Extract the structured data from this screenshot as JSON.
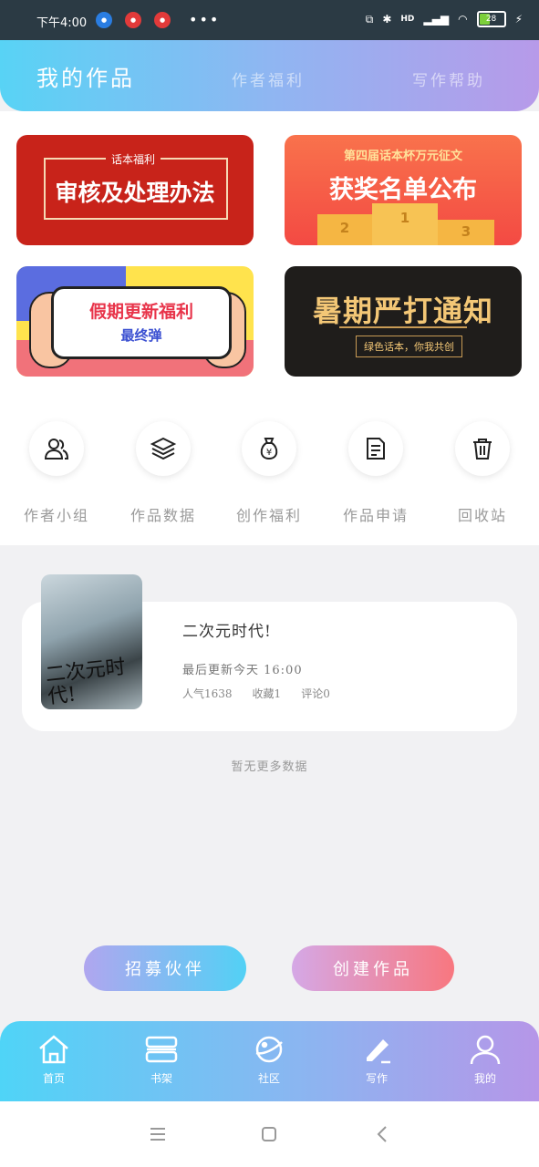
{
  "status_bar": {
    "time": "下午4:00",
    "more": "•••",
    "hd": "HD",
    "battery": "28"
  },
  "top_tabs": {
    "active": "我的作品",
    "tab2": "作者福利",
    "tab3": "写作帮助"
  },
  "banners": {
    "b1": {
      "tag": "话本福利",
      "title": "审核及处理办法"
    },
    "b2": {
      "subtitle": "第四届话本杯万元征文",
      "title": "获奖名单公布",
      "p1": "1",
      "p2": "2",
      "p3": "3"
    },
    "b3": {
      "title": "假期更新福利",
      "subtitle": "最终弹"
    },
    "b4": {
      "title": "暑期严打通知",
      "subtitle": "绿色话本，你我共创"
    }
  },
  "shortcuts": [
    {
      "label": "作者小组",
      "icon": "users-icon"
    },
    {
      "label": "作品数据",
      "icon": "layers-icon"
    },
    {
      "label": "创作福利",
      "icon": "money-bag-icon"
    },
    {
      "label": "作品申请",
      "icon": "document-icon"
    },
    {
      "label": "回收站",
      "icon": "trash-icon"
    }
  ],
  "work": {
    "cover_text": "二次元时代!",
    "title": "二次元时代!",
    "updated": "最后更新今天 16:00",
    "popularity": "人气1638",
    "favorites": "收藏1",
    "comments": "评论0"
  },
  "no_more": "暂无更多数据",
  "buttons": {
    "recommend": "招募伙伴",
    "create": "创建作品"
  },
  "bottom_nav": [
    {
      "label": "首页",
      "icon": "home-icon"
    },
    {
      "label": "书架",
      "icon": "bookshelf-icon"
    },
    {
      "label": "社区",
      "icon": "planet-icon"
    },
    {
      "label": "写作",
      "icon": "pen-icon"
    },
    {
      "label": "我的",
      "icon": "user-icon"
    }
  ],
  "colors": {
    "accent_blue": "#58d3f5",
    "accent_purple": "#b79ae9",
    "accent_pink": "#f8777f"
  }
}
